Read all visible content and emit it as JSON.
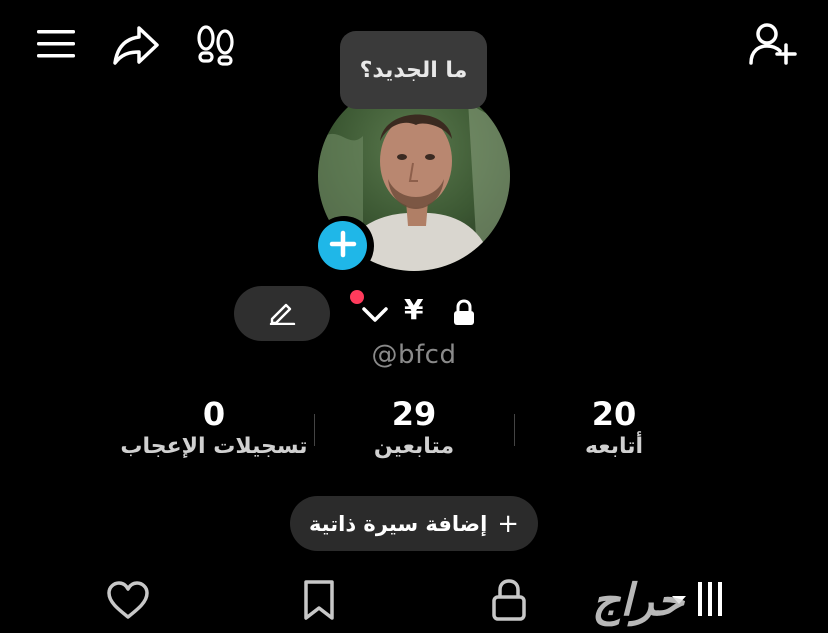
{
  "top_bar": {
    "menu_icon": "hamburger-menu-icon",
    "share_icon": "share-arrow-icon",
    "footprint_icon": "footprints-icon",
    "add_friend_icon": "person-add-icon"
  },
  "tooltip": {
    "text": "ما الجديد؟"
  },
  "profile": {
    "avatar_icon": "profile-photo",
    "add_story_icon": "plus-icon",
    "edit_icon": "pencil-icon",
    "chevron_icon": "chevron-down-icon",
    "currency_symbol": "¥",
    "lock_icon": "lock-icon",
    "handle": "@bfcd"
  },
  "stats": {
    "likes": {
      "value": "0",
      "label": "تسجيلات الإعجاب"
    },
    "followers": {
      "value": "29",
      "label": "متابعين"
    },
    "following": {
      "value": "20",
      "label": "أتابعه"
    }
  },
  "bio_button": {
    "plus": "+",
    "label": "إضافة سيرة ذاتية"
  },
  "bottom_tabs": {
    "icons": [
      "heart-icon",
      "bookmark-icon",
      "lock-icon",
      "grid-icon"
    ]
  },
  "watermark": {
    "text": "حراج"
  },
  "colors": {
    "accent_blue": "#1fb7e8",
    "notification_red": "#ff3b5c",
    "background": "#000000"
  }
}
